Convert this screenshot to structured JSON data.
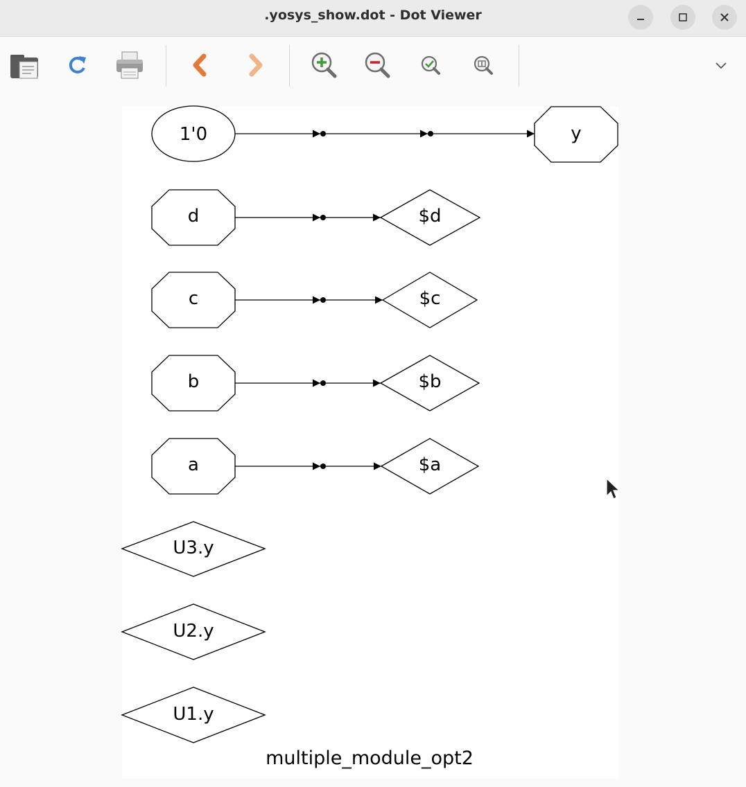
{
  "window": {
    "title": ".yosys_show.dot - Dot Viewer"
  },
  "window_controls": [
    {
      "name": "minimize-button",
      "icon": "minimize-icon"
    },
    {
      "name": "maximize-button",
      "icon": "maximize-icon"
    },
    {
      "name": "close-button",
      "icon": "close-icon"
    }
  ],
  "toolbar": {
    "buttons": [
      {
        "name": "open-button",
        "icon": "folder-icon"
      },
      {
        "name": "reload-button",
        "icon": "reload-icon"
      },
      {
        "name": "print-button",
        "icon": "printer-icon"
      },
      {
        "name": "back-button",
        "icon": "chevron-left-icon"
      },
      {
        "name": "forward-button",
        "icon": "chevron-right-icon"
      },
      {
        "name": "zoom-in-button",
        "icon": "zoom-in-icon"
      },
      {
        "name": "zoom-out-button",
        "icon": "zoom-out-icon"
      },
      {
        "name": "zoom-fit-button",
        "icon": "zoom-fit-icon"
      },
      {
        "name": "zoom-100-button",
        "icon": "zoom-100-icon"
      },
      {
        "name": "overflow-menu-button",
        "icon": "chevron-down-icon"
      }
    ],
    "colors": {
      "nav_arrow": "#e27a3a",
      "zoom_in": "#3f9a3a",
      "zoom_out": "#c8202a",
      "reload": "#3d7fd1"
    }
  },
  "graph": {
    "nodes": {
      "const": "1'0",
      "out_y": "y",
      "in_d": "d",
      "in_c": "c",
      "in_b": "b",
      "in_a": "a",
      "wire_d": "$d",
      "wire_c": "$c",
      "wire_b": "$b",
      "wire_a": "$a",
      "u3": "U3.y",
      "u2": "U2.y",
      "u1": "U1.y"
    },
    "label": "multiple_module_opt2"
  }
}
